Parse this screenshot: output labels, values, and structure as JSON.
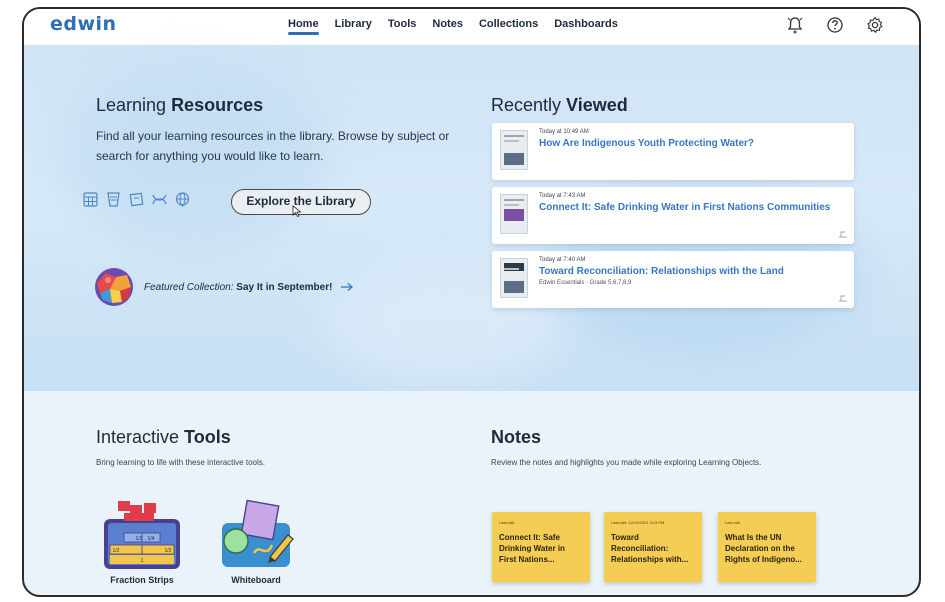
{
  "app": {
    "logo": "edwin"
  },
  "nav": {
    "items": [
      "Home",
      "Library",
      "Tools",
      "Notes",
      "Collections",
      "Dashboards"
    ],
    "active": "Home",
    "icons": [
      "bell-icon",
      "help-icon",
      "settings-icon"
    ]
  },
  "learning_resources": {
    "title_light": "Learning ",
    "title_bold": "Resources",
    "description": "Find all your learning resources in the library. Browse by subject or search for anything you would like to learn.",
    "subject_icons": [
      "calculator-icon",
      "book-icon",
      "document-icon",
      "dna-icon",
      "globe-icon"
    ],
    "explore_button": "Explore the Library"
  },
  "featured": {
    "label": "Featured Collection:",
    "name": "Say It in September!"
  },
  "recently_viewed": {
    "title_light": "Recently ",
    "title_bold": "Viewed",
    "items": [
      {
        "time": "Today at 10:49 AM",
        "title": "How Are Indigenous Youth Protecting Water?",
        "meta": ""
      },
      {
        "time": "Today at 7:43 AM",
        "title": "Connect It: Safe Drinking Water in First Nations Communities",
        "meta": ""
      },
      {
        "time": "Today at 7:40 AM",
        "title": "Toward Reconciliation: Relationships with the Land",
        "meta": "Edwin Essentials · Grade 5,6,7,8,9"
      }
    ]
  },
  "interactive_tools": {
    "title_light": "Interactive ",
    "title_bold": "Tools",
    "description": "Bring learning to life with these interactive tools.",
    "tools": [
      {
        "label": "Fraction Strips",
        "strip_labels": [
          "1/3",
          "1/4",
          "1/2",
          "1/2",
          "1"
        ]
      },
      {
        "label": "Whiteboard"
      }
    ]
  },
  "notes": {
    "title": "Notes",
    "description": "Review the notes and highlights you made while exploring Learning Objects.",
    "items": [
      {
        "edited": "Last edit",
        "title": "Connect It: Safe Drinking Water in First Nations..."
      },
      {
        "edited": "Last edit: 12/13/2024 3:13 PM",
        "title": "Toward Reconciliation: Relationships with..."
      },
      {
        "edited": "Last edit",
        "title": "What Is the UN Declaration on the Rights of Indigeno..."
      }
    ]
  },
  "colors": {
    "brand": "#2f6eb6",
    "link": "#3577c1",
    "hero_bg": "#d6e9f8",
    "note_bg": "#f4cd55"
  }
}
